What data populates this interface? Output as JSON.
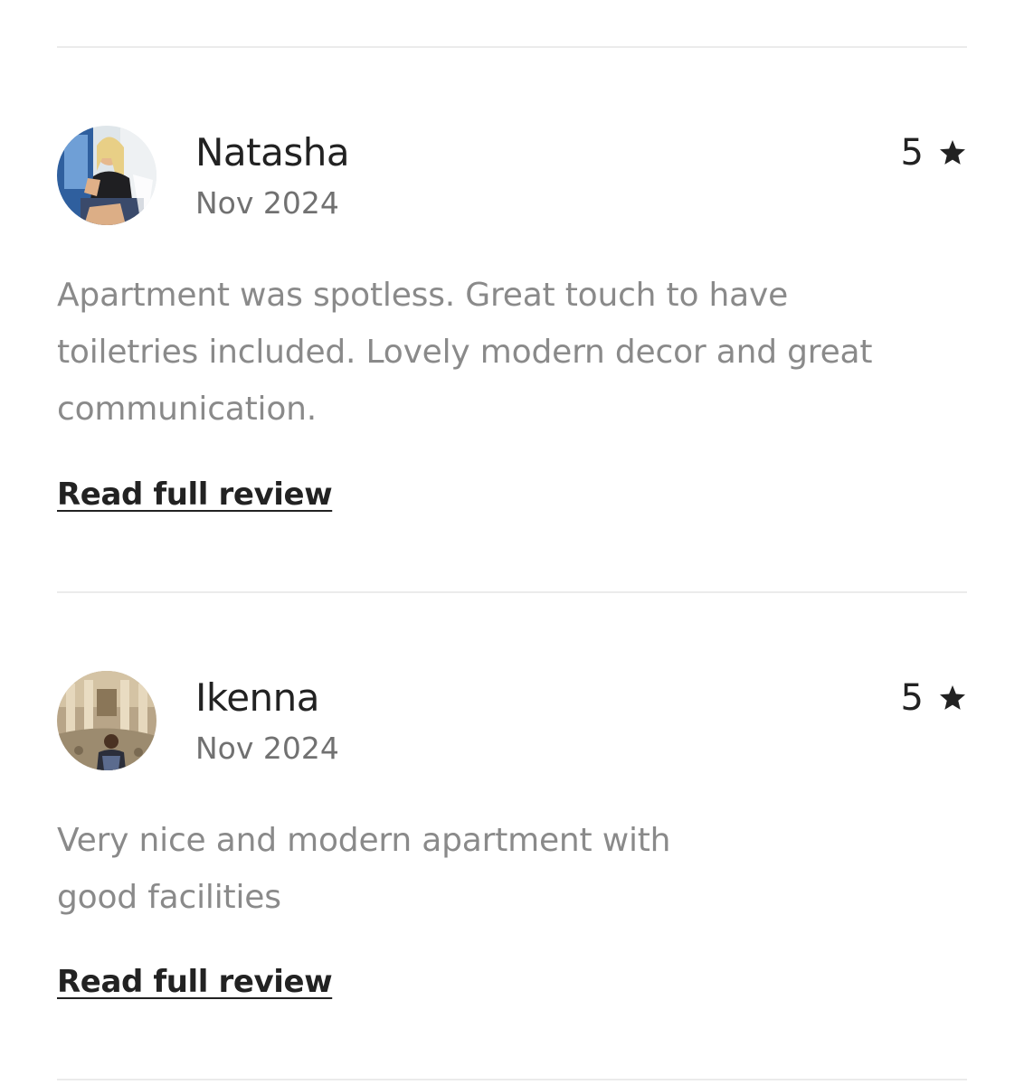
{
  "reviews": [
    {
      "name": "Natasha",
      "date": "Nov 2024",
      "rating": "5",
      "text": "Apartment was spotless. Great touch to have\ntoiletries included. Lovely modern decor and great\ncommunication.",
      "link": "Read full review",
      "avatar": "woman-sitting-by-window-photo"
    },
    {
      "name": "Ikenna",
      "date": "Nov 2024",
      "rating": "5",
      "text": "Very nice and modern apartment with\ngood facilities",
      "link": "Read full review",
      "avatar": "man-at-trevi-fountain-photo"
    }
  ],
  "colors": {
    "primary_text": "#222222",
    "secondary_text": "#717171",
    "body_text": "#8a8a8a",
    "divider": "#ebebeb"
  },
  "icons": {
    "rating": "star-icon"
  }
}
